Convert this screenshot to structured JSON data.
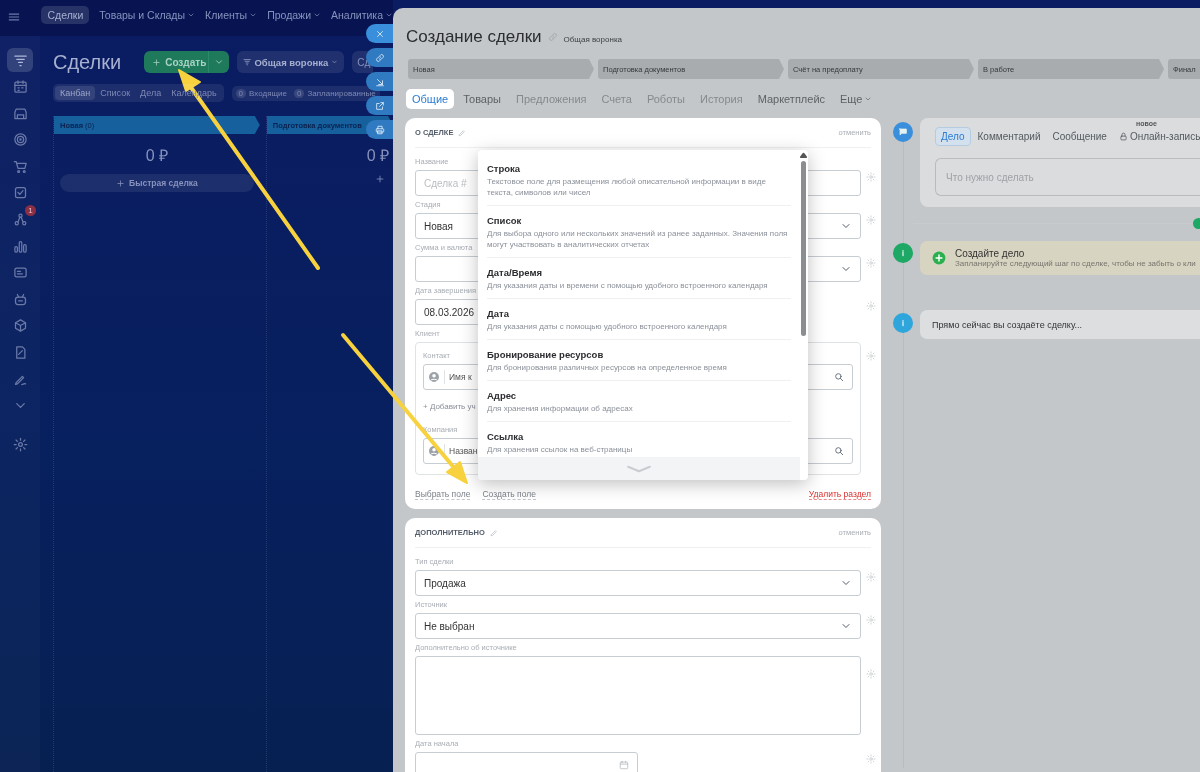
{
  "top_nav": [
    {
      "label": "Сделки",
      "selected": true,
      "menu": false
    },
    {
      "label": "Товары и Склады",
      "selected": false,
      "menu": true
    },
    {
      "label": "Клиенты",
      "selected": false,
      "menu": true
    },
    {
      "label": "Продажи",
      "selected": false,
      "menu": true
    },
    {
      "label": "Аналитика",
      "selected": false,
      "menu": true
    }
  ],
  "left_menu": [
    {
      "selected": true
    },
    {
      "selected": false
    },
    {
      "selected": false
    },
    {
      "selected": false
    },
    {
      "selected": false
    },
    {
      "selected": false
    },
    {
      "selected": false,
      "badge": "1"
    },
    {
      "selected": false
    },
    {
      "selected": false
    },
    {
      "selected": false
    },
    {
      "selected": false
    },
    {
      "selected": false
    },
    {
      "selected": false
    },
    {
      "selected": false
    },
    {
      "selected": false
    }
  ],
  "page": {
    "title": "Сделки",
    "create_button": "Создать",
    "funnel_button": "Общая воронка",
    "extra_button": "Сд"
  },
  "view_tabs": [
    {
      "label": "Канбан",
      "selected": true
    },
    {
      "label": "Список",
      "selected": false
    },
    {
      "label": "Дела",
      "selected": false
    },
    {
      "label": "Календарь",
      "selected": false
    }
  ],
  "counters": [
    {
      "count": "0",
      "label": "Входящие"
    },
    {
      "count": "0",
      "label": "Запланированные"
    }
  ],
  "kanban_columns": [
    {
      "title": "Новая",
      "count": "(0)",
      "total": "0 ₽",
      "quick_add": "Быстрая сделка"
    },
    {
      "title": "Подготовка документов",
      "total": "0 ₽"
    }
  ],
  "deal_form": {
    "title": "Создание сделки",
    "funnel": "Общая воронка",
    "stages": [
      "Новая",
      "Подготовка документов",
      "Счёт на предоплату",
      "В работе",
      "Финал"
    ],
    "tabs": [
      {
        "label": "Общие",
        "selected": true,
        "disabled": false
      },
      {
        "label": "Товары",
        "selected": false,
        "disabled": false
      },
      {
        "label": "Предложения",
        "selected": false,
        "disabled": true
      },
      {
        "label": "Счета",
        "selected": false,
        "disabled": true
      },
      {
        "label": "Роботы",
        "selected": false,
        "disabled": true
      },
      {
        "label": "История",
        "selected": false,
        "disabled": true
      },
      {
        "label": "Маркетплейс",
        "selected": false,
        "disabled": false
      },
      {
        "label": "Еще",
        "selected": false,
        "disabled": false,
        "menu": true
      }
    ],
    "sections": [
      {
        "title": "О СДЕЛКЕ",
        "cancel": "отменить",
        "fields": [
          {
            "kind": "input",
            "label": "Название",
            "placeholder": "Сделка #"
          },
          {
            "kind": "select",
            "label": "Стадия",
            "value": "Новая"
          },
          {
            "kind": "money",
            "label": "Сумма и валюта"
          },
          {
            "kind": "date",
            "label": "Дата завершения",
            "value": "08.03.2026"
          },
          {
            "kind": "client",
            "label": "Клиент",
            "contact_label": "Контакт",
            "contact_placeholder": "Имя к",
            "add_link": "+ Добавить уч",
            "company_label": "Компания",
            "company_placeholder": "Назван"
          }
        ],
        "footer_links": [
          "Выбрать поле",
          "Создать поле"
        ],
        "delete_link": "Удалить раздел"
      },
      {
        "title": "ДОПОЛНИТЕЛЬНО",
        "cancel": "отменить",
        "fields": [
          {
            "kind": "select",
            "label": "Тип сделки",
            "value": "Продажа"
          },
          {
            "kind": "select",
            "label": "Источник",
            "value": "Не выбран"
          },
          {
            "kind": "textarea",
            "label": "Дополнительно об источнике"
          },
          {
            "kind": "date",
            "label": "Дата начала"
          }
        ]
      }
    ],
    "field_types_popup": {
      "items": [
        {
          "title": "Строка",
          "description": "Текстовое поле для размещения любой описательной информации в виде текста, символов или чисел"
        },
        {
          "title": "Список",
          "description": "Для выбора одного или нескольких значений из ранее заданных. Значения поля могут участвовать в аналитических отчетах"
        },
        {
          "title": "Дата/Время",
          "description": "Для указания даты и времени с помощью удобного встроенного календаря"
        },
        {
          "title": "Дата",
          "description": "Для указания даты с помощью удобного встроенного календаря"
        },
        {
          "title": "Бронирование ресурсов",
          "description": "Для бронирования различных ресурсов на определенное время"
        },
        {
          "title": "Адрес",
          "description": "Для хранения информации об адресах"
        },
        {
          "title": "Ссылка",
          "description": "Для хранения ссылок на веб-страницы"
        }
      ]
    },
    "timeline": {
      "composer_tabs": [
        {
          "label": "Дело",
          "selected": true,
          "locked": false
        },
        {
          "label": "Комментарий",
          "selected": false,
          "locked": false
        },
        {
          "label": "Сообщение",
          "selected": false,
          "locked": false
        },
        {
          "label": "Онлайн-запись",
          "selected": false,
          "locked": true,
          "badge": "новое"
        }
      ],
      "placeholder": "Что нужно сделать",
      "items": [
        {
          "kind": "todo",
          "title": "Создайте дело",
          "text": "Запланируйте следующий шаг по сделке, чтобы не забыть о кли"
        },
        {
          "kind": "info",
          "text": "Прямо сейчас вы создаёте сделку..."
        }
      ]
    }
  }
}
